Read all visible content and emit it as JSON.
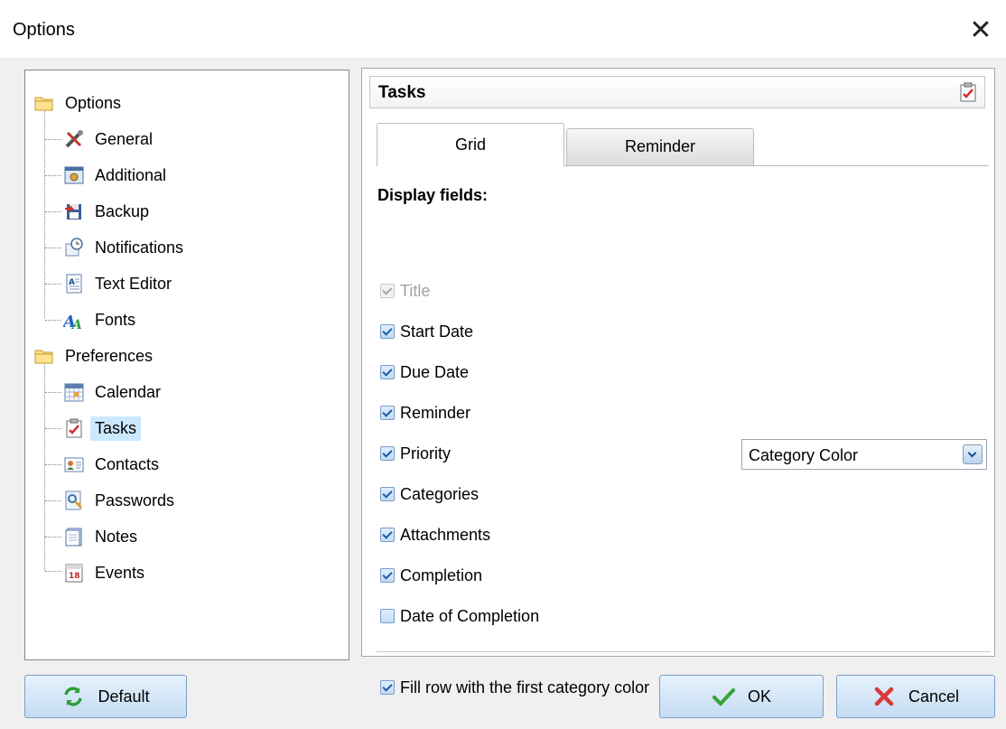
{
  "window": {
    "title": "Options",
    "close_glyph": "✕"
  },
  "tree": {
    "groups": [
      {
        "label": "Options",
        "icon": "folder-icon",
        "items": [
          {
            "label": "General",
            "icon": "tools-icon"
          },
          {
            "label": "Additional",
            "icon": "settings-window-icon"
          },
          {
            "label": "Backup",
            "icon": "backup-icon"
          },
          {
            "label": "Notifications",
            "icon": "notification-clock-icon"
          },
          {
            "label": "Text Editor",
            "icon": "text-editor-icon"
          },
          {
            "label": "Fonts",
            "icon": "fonts-icon"
          }
        ]
      },
      {
        "label": "Preferences",
        "icon": "folder-icon",
        "items": [
          {
            "label": "Calendar",
            "icon": "calendar-icon"
          },
          {
            "label": "Tasks",
            "icon": "tasks-icon",
            "selected": true
          },
          {
            "label": "Contacts",
            "icon": "contact-card-icon"
          },
          {
            "label": "Passwords",
            "icon": "password-key-icon"
          },
          {
            "label": "Notes",
            "icon": "notepad-icon"
          },
          {
            "label": "Events",
            "icon": "event-calendar-icon",
            "day": "18"
          }
        ]
      }
    ]
  },
  "panel": {
    "title": "Tasks",
    "tabs": [
      {
        "label": "Grid",
        "active": true
      },
      {
        "label": "Reminder",
        "active": false
      }
    ],
    "section_label": "Display fields:",
    "fields": [
      {
        "label": "Title",
        "checked": true,
        "disabled": true
      },
      {
        "label": "Start Date",
        "checked": true
      },
      {
        "label": "Due Date",
        "checked": true
      },
      {
        "label": "Reminder",
        "checked": true
      },
      {
        "label": "Priority",
        "checked": true
      },
      {
        "label": "Categories",
        "checked": true
      },
      {
        "label": "Attachments",
        "checked": true
      },
      {
        "label": "Completion",
        "checked": true
      },
      {
        "label": "Date of Completion",
        "checked": false
      }
    ],
    "category_display": {
      "value": "Category Color"
    },
    "fill_row": {
      "label": "Fill row with the first category color",
      "checked": true
    }
  },
  "buttons": {
    "default": "Default",
    "ok": "OK",
    "cancel": "Cancel"
  },
  "colors": {
    "selection": "#cce8ff",
    "button_top": "#e6f1fc",
    "button_bottom": "#c5dcf3",
    "check_mark": "#1d5ba7"
  }
}
